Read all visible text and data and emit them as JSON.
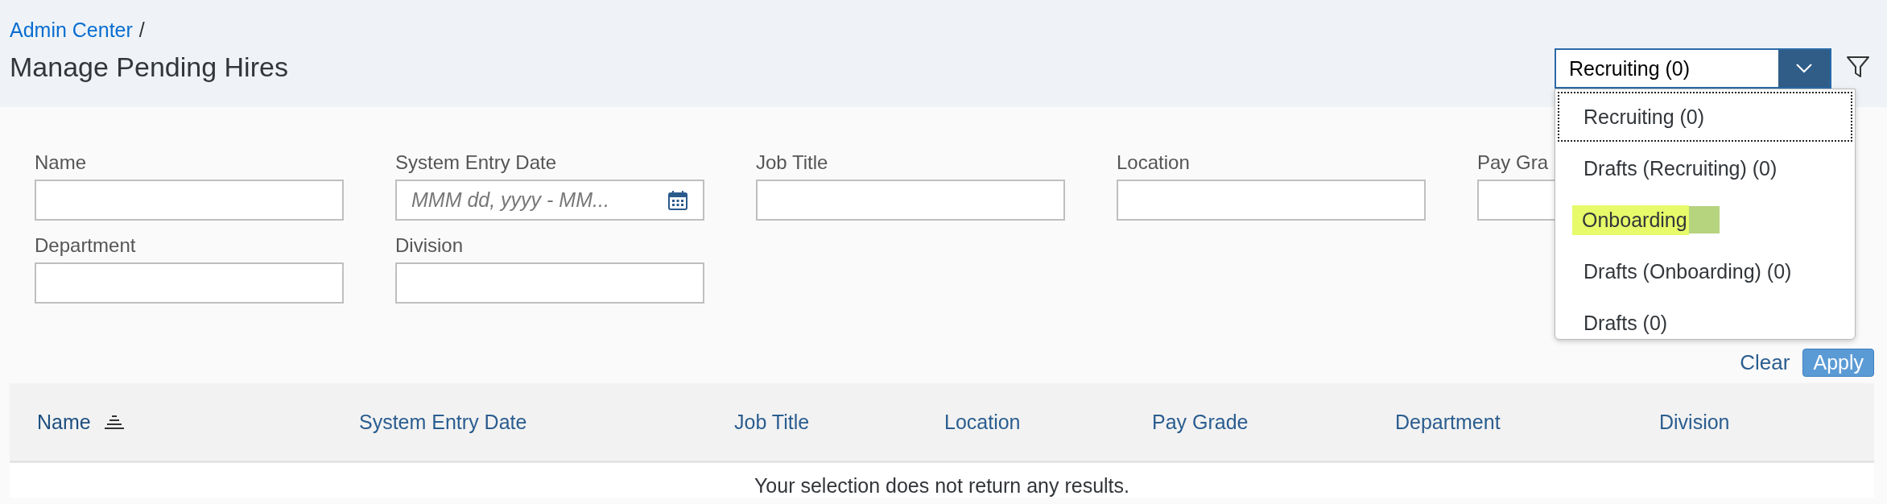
{
  "breadcrumb": {
    "link": "Admin Center",
    "separator": "/"
  },
  "title": "Manage Pending Hires",
  "view_select": {
    "value": "Recruiting (0)",
    "expanded": true,
    "options": [
      {
        "label": "Recruiting (0)",
        "focused": true,
        "highlighted": false,
        "redacted": false
      },
      {
        "label": "Drafts (Recruiting) (0)",
        "focused": false,
        "highlighted": false,
        "redacted": false
      },
      {
        "label": "Onboarding",
        "focused": false,
        "highlighted": true,
        "redacted": true
      },
      {
        "label": "Drafts (Onboarding) (0)",
        "focused": false,
        "highlighted": false,
        "redacted": false
      },
      {
        "label": "Drafts (0)",
        "focused": false,
        "highlighted": false,
        "redacted": false
      }
    ]
  },
  "filters": [
    [
      {
        "label": "Name"
      },
      {
        "label": "System Entry Date",
        "placeholder": "MMM dd, yyyy - MM...",
        "kind": "date"
      },
      {
        "label": "Job Title"
      },
      {
        "label": "Location"
      },
      {
        "label": "Pay Gra"
      }
    ],
    [
      {
        "label": "Department"
      },
      {
        "label": "Division"
      }
    ]
  ],
  "actions": {
    "clear": "Clear",
    "apply": "Apply"
  },
  "table": {
    "columns": [
      {
        "label": "Name",
        "sorted": true
      },
      {
        "label": "System Entry Date",
        "sorted": false
      },
      {
        "label": "Job Title",
        "sorted": false
      },
      {
        "label": "Location",
        "sorted": false
      },
      {
        "label": "Pay Grade",
        "sorted": false
      },
      {
        "label": "Department",
        "sorted": false
      },
      {
        "label": "Division",
        "sorted": false
      }
    ],
    "empty_message": "Your selection does not return any results."
  }
}
